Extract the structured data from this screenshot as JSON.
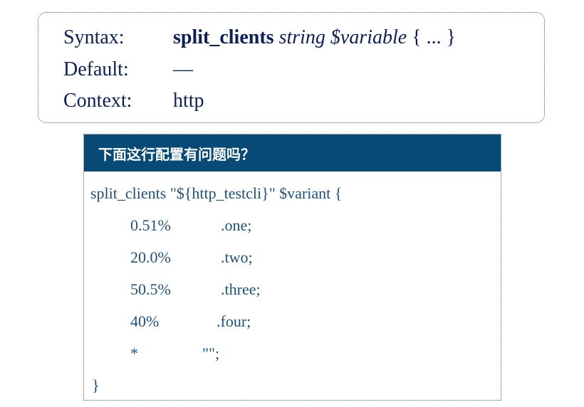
{
  "syntax_box": {
    "rows": [
      {
        "label": "Syntax:",
        "keyword": "split_clients",
        "args": "string $variable",
        "rest": " { ... }"
      },
      {
        "label": "Default:",
        "value": "—"
      },
      {
        "label": "Context:",
        "value": "http"
      }
    ]
  },
  "question": {
    "title": "下面这行配置有问题吗？",
    "first_line": "split_clients \"${http_testcli}\" $variant {",
    "entries": [
      {
        "percent": "0.51%",
        "value": ".one;"
      },
      {
        "percent": "20.0%",
        "value": ".two;"
      },
      {
        "percent": "50.5%",
        "value": ".three;"
      },
      {
        "percent": "40%",
        "value": ".four;"
      },
      {
        "percent": "*",
        "value": "\"\";"
      }
    ],
    "last_line": "}"
  },
  "colors": {
    "header_bg": "#064a75",
    "code_text": "#1d4f80",
    "syntax_text": "#0d1f5a"
  }
}
